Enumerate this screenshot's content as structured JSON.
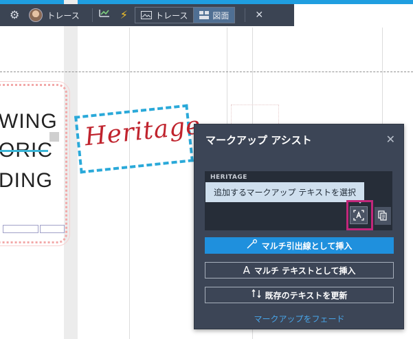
{
  "toolbar": {
    "trace_label": "トレース",
    "seg_trace_label": "トレース",
    "seg_drawing_label": "図面",
    "close_glyph": "✕",
    "gear_icon": "gear-icon",
    "check_icon": "chart-check-icon",
    "bolt_icon": "lightning-icon",
    "accent": "#1f9ee0"
  },
  "canvas": {
    "lines": [
      "WING",
      "ORIC",
      "DING"
    ],
    "stamp_text": "Heritage"
  },
  "panel": {
    "title": "マークアップ アシスト",
    "text_label": "HERITAGE",
    "tooltip": "追加するマークアップ テキストを選択",
    "select_icon": "select-text-icon",
    "copy_icon": "copy-icon",
    "buttons": [
      {
        "label": "マルチ引出線として挿入",
        "icon": "leader-icon"
      },
      {
        "label": "マルチ テキストとして挿入",
        "icon": "text-A-icon"
      },
      {
        "label": "既存のテキストを更新",
        "icon": "update-icon"
      }
    ],
    "fade_link": "マークアップをフェード",
    "highlight_color": "#c2277b",
    "primary_color": "#1f90dd"
  }
}
